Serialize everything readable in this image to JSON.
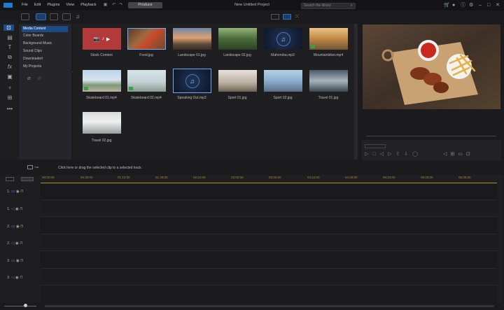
{
  "titlebar": {
    "menu": [
      "File",
      "Edit",
      "Plugins",
      "View",
      "Playback"
    ],
    "produce_label": "Produce",
    "project_title": "New Untitled Project"
  },
  "library": {
    "search_placeholder": "Search the library",
    "categories": [
      "Media Content",
      "Color Boards",
      "Background Music",
      "Sound Clips",
      "Downloaded",
      "My Projects"
    ],
    "items": [
      {
        "label": "Stock Content",
        "kind": "stock"
      },
      {
        "label": "Food.jpg",
        "kind": "image"
      },
      {
        "label": "Landscape 01.jpg",
        "kind": "image"
      },
      {
        "label": "Landscape 02.jpg",
        "kind": "image"
      },
      {
        "label": "Mahoroba.mp3",
        "kind": "audio"
      },
      {
        "label": "Mountainbiker.mp4",
        "kind": "video"
      },
      {
        "label": "Skateboard 01.mp4",
        "kind": "video"
      },
      {
        "label": "Skateboard 02.mp4",
        "kind": "video"
      },
      {
        "label": "Speaking Out.mp3",
        "kind": "audio"
      },
      {
        "label": "Sport 01.jpg",
        "kind": "image"
      },
      {
        "label": "Sport 02.jpg",
        "kind": "image"
      },
      {
        "label": "Travel 01.jpg",
        "kind": "image"
      },
      {
        "label": "Travel 02.jpg",
        "kind": "image"
      }
    ]
  },
  "timeline": {
    "hint": "Click here or drag the selected clip to a selected track.",
    "ticks": [
      "00:00:00",
      "00:36:00",
      "01:12:00",
      "01:48:00",
      "02:24:00",
      "03:00:00",
      "03:36:00",
      "04:12:00",
      "04:48:00",
      "05:24:00",
      "06:00:00",
      "06:36:00"
    ],
    "tracks": [
      {
        "number": "1.",
        "type": "video"
      },
      {
        "number": "1.",
        "type": "audio"
      },
      {
        "number": "2.",
        "type": "video"
      },
      {
        "number": "2.",
        "type": "audio"
      },
      {
        "number": "3.",
        "type": "video"
      },
      {
        "number": "3.",
        "type": "audio"
      }
    ]
  },
  "colors": {
    "accent": "#1e4b86",
    "ruler": "#b0922a",
    "bg": "#1b1b1d"
  }
}
